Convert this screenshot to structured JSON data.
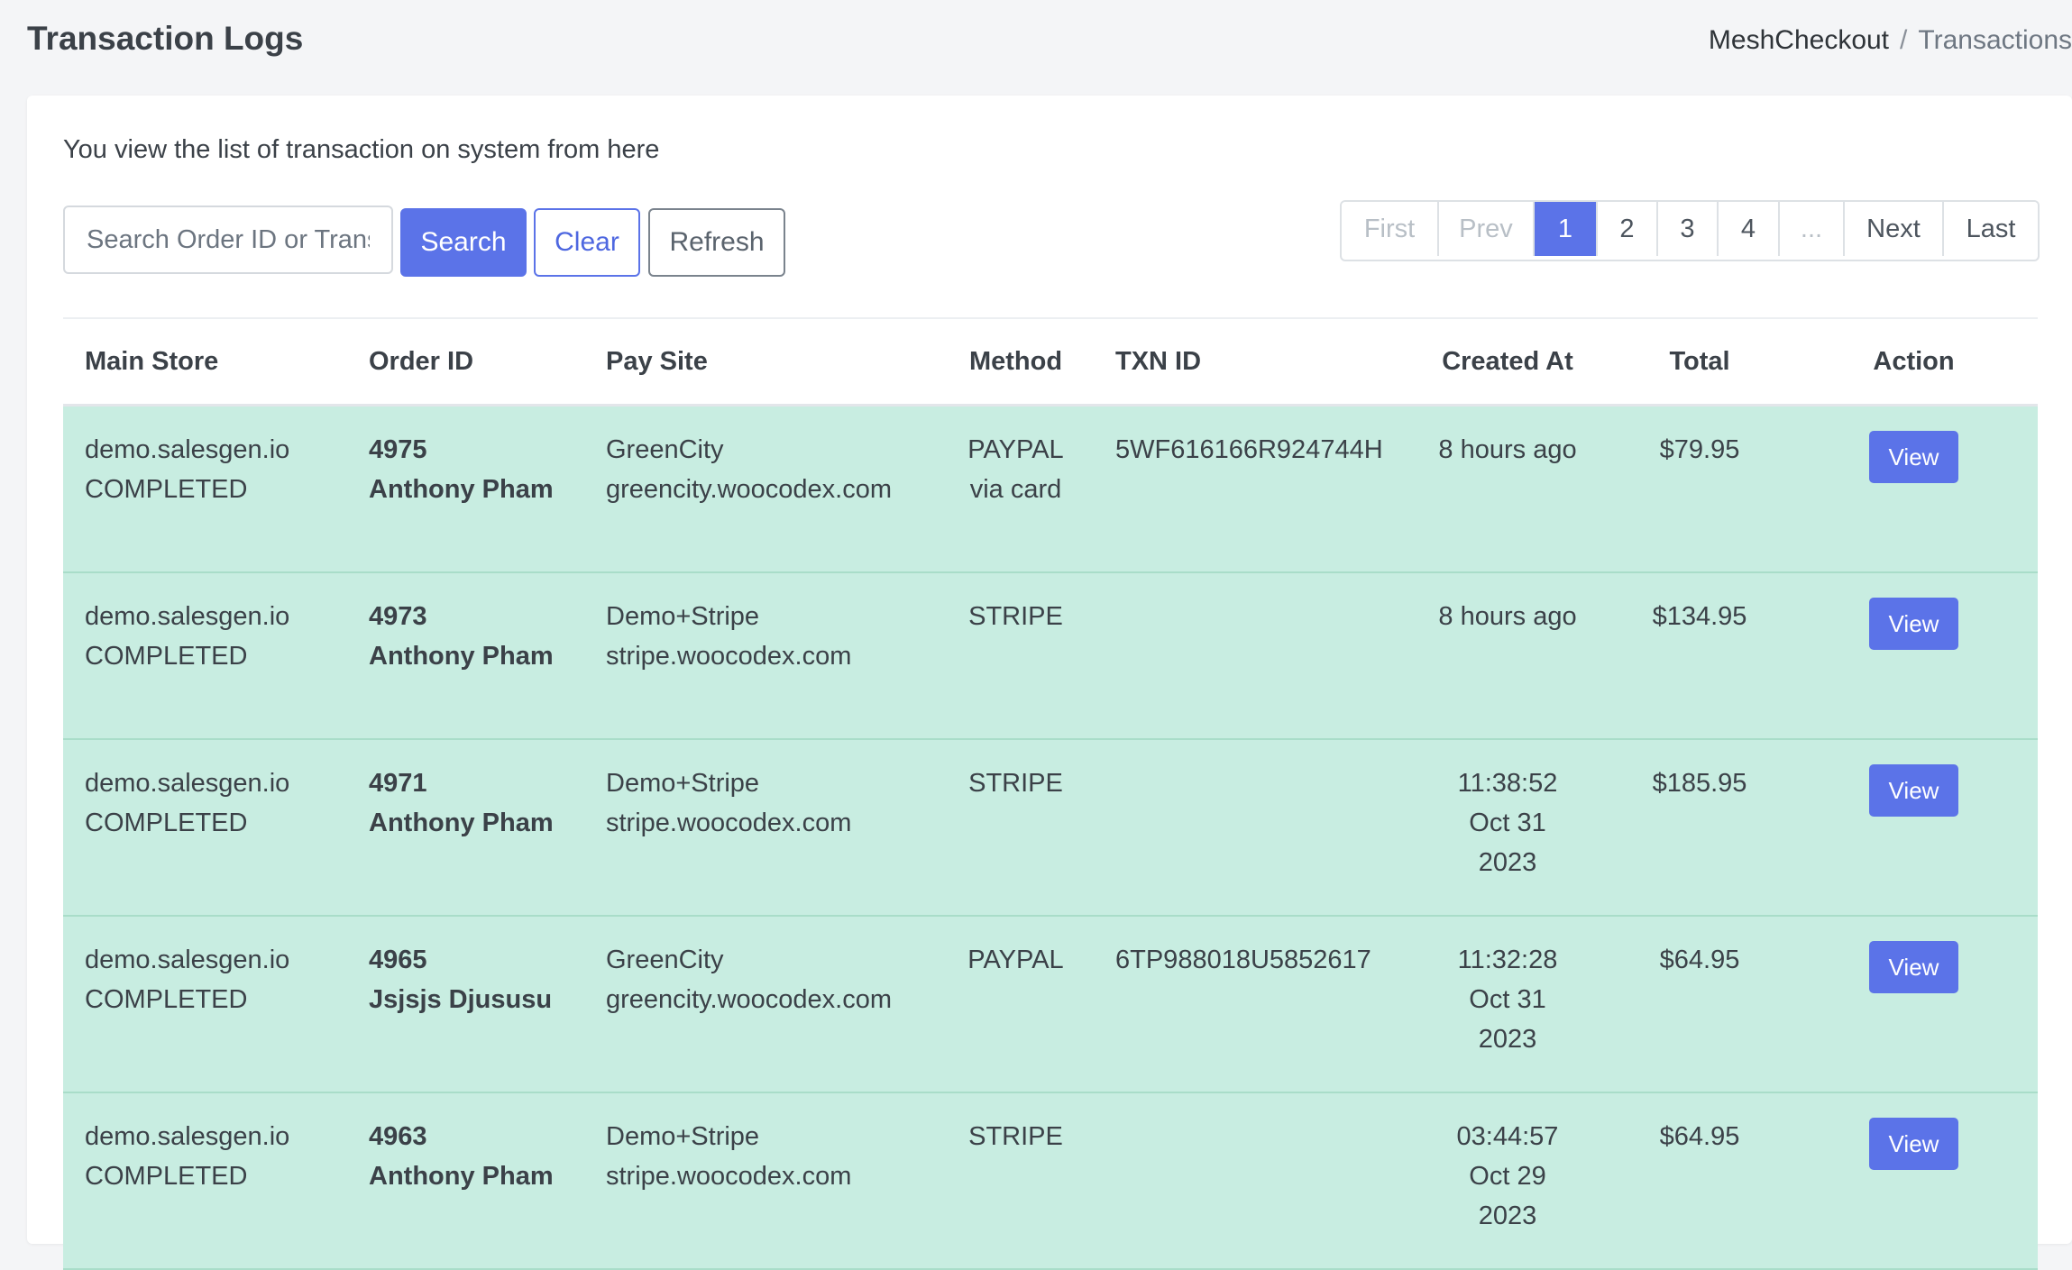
{
  "header": {
    "title": "Transaction Logs",
    "breadcrumb": {
      "home": "MeshCheckout",
      "separator": "/",
      "current": "Transactions"
    }
  },
  "card": {
    "subtitle": "You view the list of transaction on system from here"
  },
  "search": {
    "placeholder": "Search Order ID or Transaction ID",
    "value": "",
    "search_label": "Search",
    "clear_label": "Clear",
    "refresh_label": "Refresh"
  },
  "pagination": {
    "first": "First",
    "prev": "Prev",
    "pages": [
      "1",
      "2",
      "3",
      "4",
      "..."
    ],
    "current": "1",
    "next": "Next",
    "last": "Last"
  },
  "table": {
    "headers": [
      "Main Store",
      "Order ID",
      "Pay Site",
      "Method",
      "TXN ID",
      "Created At",
      "Total",
      "Action"
    ],
    "rows": [
      {
        "store": "demo.salesgen.io",
        "status": "COMPLETED",
        "order_id": "4975",
        "customer": "Anthony Pham",
        "site_name": "GreenCity",
        "site_domain": "greencity.woocodex.com",
        "method": "PAYPAL via card",
        "txn_id": "5WF616166R924744H",
        "created": [
          "8 hours ago"
        ],
        "total": "$79.95",
        "action": "View"
      },
      {
        "store": "demo.salesgen.io",
        "status": "COMPLETED",
        "order_id": "4973",
        "customer": "Anthony Pham",
        "site_name": "Demo+Stripe",
        "site_domain": "stripe.woocodex.com",
        "method": "STRIPE",
        "txn_id": "",
        "created": [
          "8 hours ago"
        ],
        "total": "$134.95",
        "action": "View"
      },
      {
        "store": "demo.salesgen.io",
        "status": "COMPLETED",
        "order_id": "4971",
        "customer": "Anthony Pham",
        "site_name": "Demo+Stripe",
        "site_domain": "stripe.woocodex.com",
        "method": "STRIPE",
        "txn_id": "",
        "created": [
          "11:38:52",
          "Oct 31",
          "2023"
        ],
        "total": "$185.95",
        "action": "View"
      },
      {
        "store": "demo.salesgen.io",
        "status": "COMPLETED",
        "order_id": "4965",
        "customer": "Jsjsjs Djususu",
        "site_name": "GreenCity",
        "site_domain": "greencity.woocodex.com",
        "method": "PAYPAL",
        "txn_id": "6TP988018U5852617",
        "created": [
          "11:32:28",
          "Oct 31",
          "2023"
        ],
        "total": "$64.95",
        "action": "View"
      },
      {
        "store": "demo.salesgen.io",
        "status": "COMPLETED",
        "order_id": "4963",
        "customer": "Anthony Pham",
        "site_name": "Demo+Stripe",
        "site_domain": "stripe.woocodex.com",
        "method": "STRIPE",
        "txn_id": "",
        "created": [
          "03:44:57",
          "Oct 29",
          "2023"
        ],
        "total": "$64.95",
        "action": "View"
      }
    ]
  }
}
